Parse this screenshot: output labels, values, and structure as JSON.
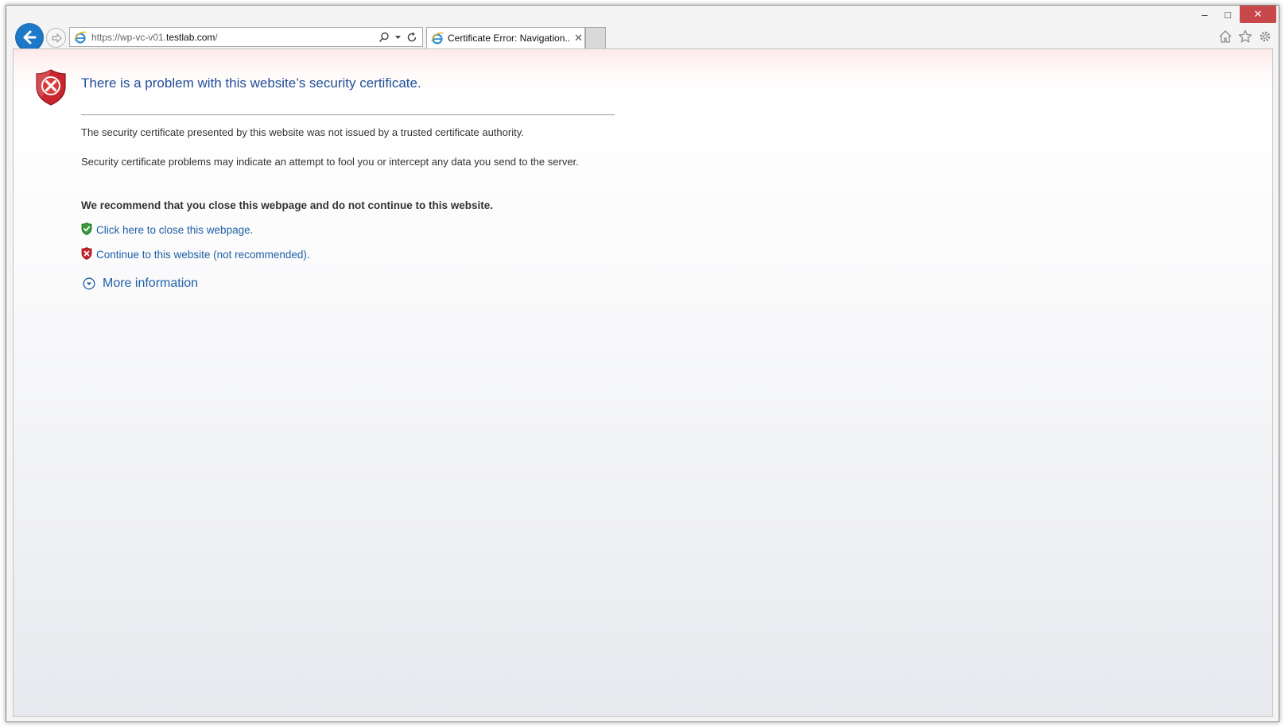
{
  "browser": {
    "address": {
      "url_prefix": "https://wp-vc-v01.",
      "url_host": "testlab.com",
      "url_suffix": "/"
    },
    "tab": {
      "label": "Certificate Error: Navigation...",
      "close_glyph": "✕"
    },
    "window_controls": {
      "minimize": "–",
      "maximize": "□",
      "close": "✕"
    }
  },
  "page": {
    "title": "There is a problem with this website’s security certificate.",
    "paragraph1": "The security certificate presented by this website was not issued by a trusted certificate authority.",
    "paragraph2": "Security certificate problems may indicate an attempt to fool you or intercept any data you send to the server.",
    "recommendation": "We recommend that you close this webpage and do not continue to this website.",
    "link_close": "Click here to close this webpage.",
    "link_continue": "Continue to this website (not recommended).",
    "more_info": "More information"
  },
  "colors": {
    "title": "#1f4e99",
    "link": "#1f5fa6",
    "back_button": "#1e78c8",
    "close_button": "#c7474b",
    "shield_red": "#c8252c",
    "shield_green": "#3a9a3a"
  },
  "icons": [
    "back-arrow-icon",
    "forward-arrow-icon",
    "ie-icon",
    "search-icon",
    "dropdown-icon",
    "refresh-icon",
    "home-icon",
    "favorites-star-icon",
    "settings-gear-icon",
    "shield-error-icon",
    "shield-ok-icon",
    "chevron-down-circle-icon"
  ]
}
